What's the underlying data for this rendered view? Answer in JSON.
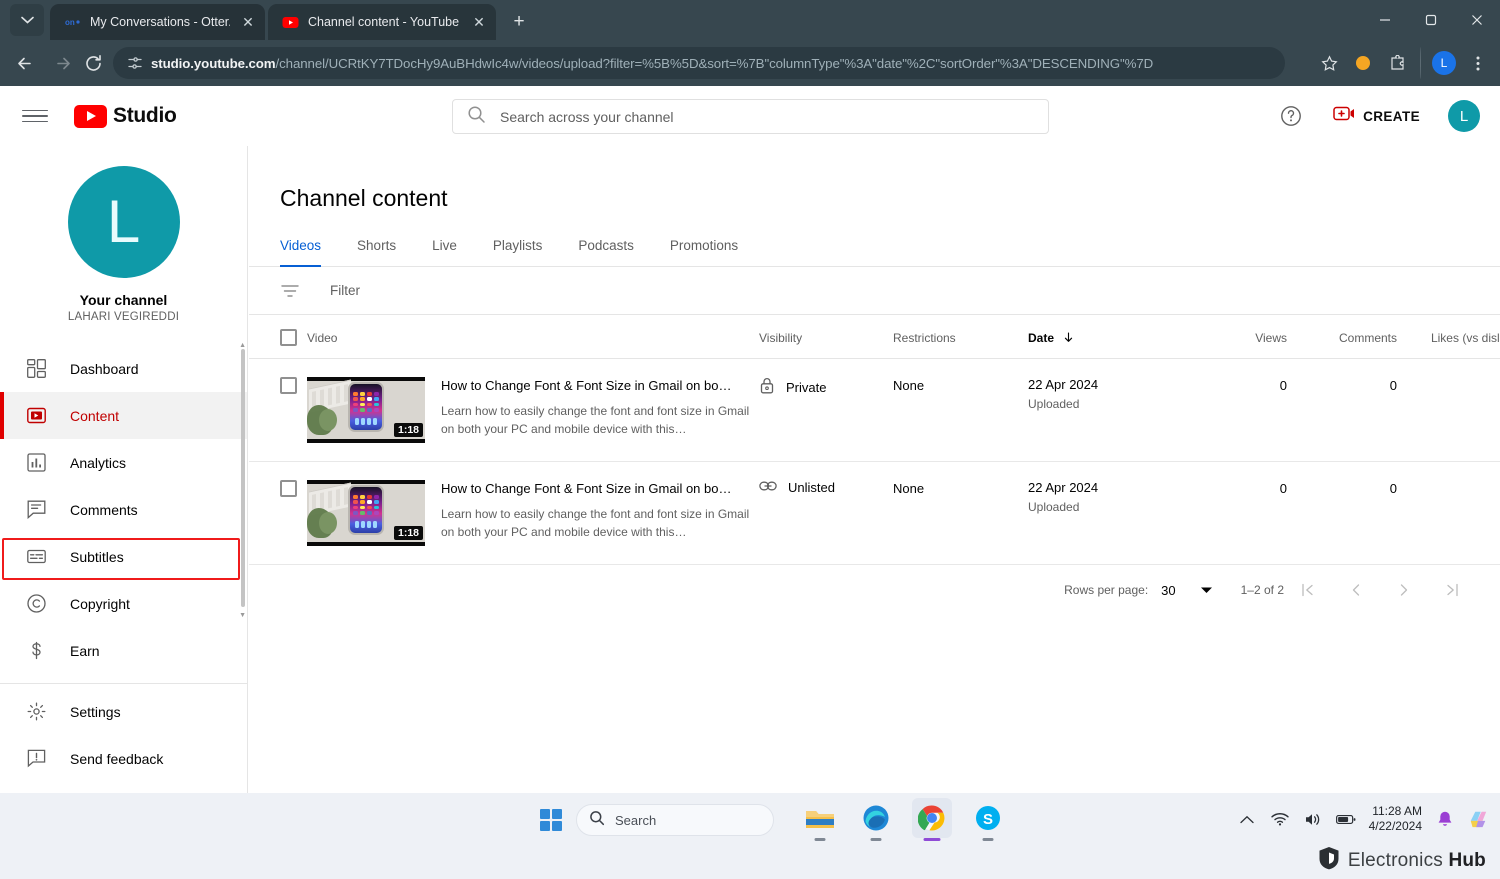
{
  "browser": {
    "tabs": [
      {
        "title": "My Conversations - Otter.ai",
        "favicon": "otter-icon",
        "active": false
      },
      {
        "title": "Channel content - YouTube Stu",
        "favicon": "youtube-icon",
        "active": true
      }
    ],
    "new_tab_label": "+",
    "window_controls": {
      "minimize": "–",
      "maximize": "❐",
      "close": "✕"
    },
    "url_domain": "studio.youtube.com",
    "url_path": "/channel/UCRtKY7TDocHy9AuBHdwIc4w/videos/upload?filter=%5B%5D&sort=%7B\"columnType\"%3A\"date\"%2C\"sortOrder\"%3A\"DESCENDING\"%7D",
    "profile_initial": "L",
    "nav": {
      "back": "back-arrow",
      "forward": "forward-arrow",
      "reload": "reload-icon"
    }
  },
  "masthead": {
    "brand_text": "Studio",
    "search_placeholder": "Search across your channel",
    "create_label": "CREATE",
    "avatar_initial": "L"
  },
  "sidebar": {
    "channel_label": "Your channel",
    "channel_name": "LAHARI VEGIREDDI",
    "avatar_initial": "L",
    "items": [
      {
        "label": "Dashboard",
        "icon": "dashboard-icon",
        "active": false
      },
      {
        "label": "Content",
        "icon": "content-play-icon",
        "active": true
      },
      {
        "label": "Analytics",
        "icon": "analytics-bars-icon",
        "active": false
      },
      {
        "label": "Comments",
        "icon": "comments-icon",
        "active": false
      },
      {
        "label": "Subtitles",
        "icon": "subtitles-icon",
        "active": false,
        "highlighted": true
      },
      {
        "label": "Copyright",
        "icon": "copyright-icon",
        "active": false
      },
      {
        "label": "Earn",
        "icon": "dollar-icon",
        "active": false
      }
    ],
    "footer_items": [
      {
        "label": "Settings",
        "icon": "gear-icon"
      },
      {
        "label": "Send feedback",
        "icon": "feedback-icon"
      }
    ],
    "highlight_color": "#f01b1b",
    "accent_color": "#c00000"
  },
  "main": {
    "page_title": "Channel content",
    "tabs": [
      {
        "label": "Videos",
        "active": true
      },
      {
        "label": "Shorts",
        "active": false
      },
      {
        "label": "Live",
        "active": false
      },
      {
        "label": "Playlists",
        "active": false
      },
      {
        "label": "Podcasts",
        "active": false
      },
      {
        "label": "Promotions",
        "active": false
      }
    ],
    "active_tab_color": "#065fd4",
    "filter_placeholder": "Filter",
    "columns": [
      "Video",
      "Visibility",
      "Restrictions",
      "Date",
      "Views",
      "Comments",
      "Likes (vs dislikes)"
    ],
    "sort_column": "Date",
    "sort_direction": "descending",
    "rows": [
      {
        "title": "How to Change Font & Font Size in Gmail on bo…",
        "description": "Learn how to easily change the font and font size in Gmail on both your PC and mobile device with this…",
        "duration": "1:18",
        "visibility": "Private",
        "visibility_icon": "lock-icon",
        "restrictions": "None",
        "date": "22 Apr 2024",
        "date_state": "Uploaded",
        "views": "0",
        "comments": "0",
        "likes": "–"
      },
      {
        "title": "How to Change Font & Font Size in Gmail on bo…",
        "description": "Learn how to easily change the font and font size in Gmail on both your PC and mobile device with this…",
        "duration": "1:18",
        "visibility": "Unlisted",
        "visibility_icon": "link-icon",
        "restrictions": "None",
        "date": "22 Apr 2024",
        "date_state": "Uploaded",
        "views": "0",
        "comments": "0",
        "likes": "–"
      }
    ],
    "pagination": {
      "rows_per_page_label": "Rows per page:",
      "rows_per_page_value": "30",
      "range": "1–2 of 2",
      "first": "|‹",
      "prev": "‹",
      "next": "›",
      "last": "›|"
    }
  },
  "taskbar": {
    "search_label": "Search",
    "apps": [
      {
        "name": "file-explorer-icon"
      },
      {
        "name": "edge-browser-icon"
      },
      {
        "name": "chrome-browser-icon"
      },
      {
        "name": "skype-icon"
      }
    ],
    "time": "11:28 AM",
    "date": "4/22/2024",
    "tray_icons": [
      "chevron-up-icon",
      "wifi-icon",
      "volume-icon",
      "battery-icon",
      "notification-bell-icon",
      "copilot-icon"
    ]
  },
  "watermark": {
    "brand_light": "Electronics ",
    "brand_bold": "Hub"
  }
}
